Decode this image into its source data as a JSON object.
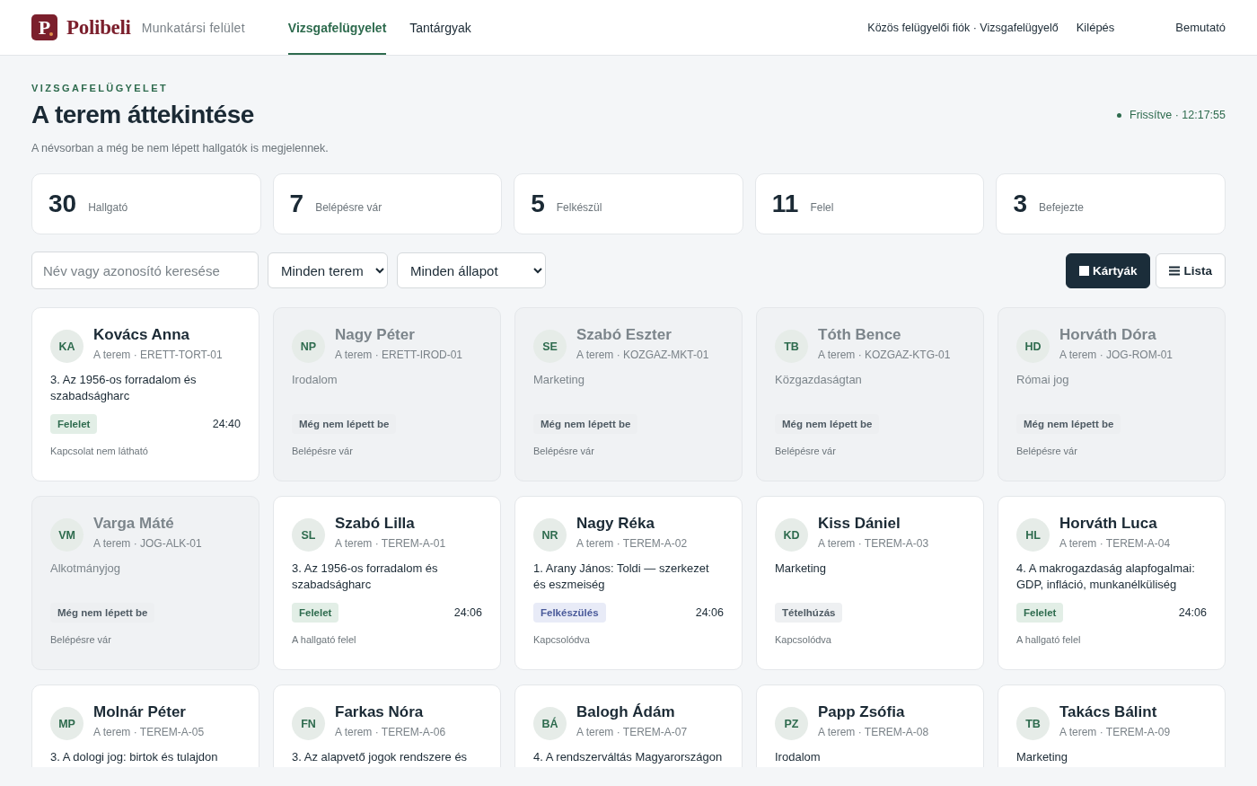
{
  "header": {
    "logo_letter": "P",
    "brand": "Polibeli",
    "subtitle": "Munkatársi felület",
    "tabs": [
      {
        "label": "Vizsgafelügyelet",
        "selected": true
      },
      {
        "label": "Tantárgyak",
        "selected": false
      }
    ],
    "account": "Közös felügyelői fiók · Vizsgafelügyelő",
    "logout": "Kilépés",
    "demo": "Bemutató"
  },
  "page": {
    "eyebrow": "VIZSGAFELÜGYELET",
    "title": "A terem áttekintése",
    "note": "A névsorban a még be nem lépett hallgatók is megjelennek.",
    "refreshed": "Frissítve · 12:17:55"
  },
  "stats": [
    {
      "value": "30",
      "label": "Hallgató"
    },
    {
      "value": "7",
      "label": "Belépésre vár"
    },
    {
      "value": "5",
      "label": "Felkészül"
    },
    {
      "value": "11",
      "label": "Felel"
    },
    {
      "value": "3",
      "label": "Befejezte"
    }
  ],
  "filters": {
    "search": {
      "placeholder": "Név vagy azonosító keresése"
    },
    "room": "Minden terem",
    "status": "Minden állapot",
    "views": [
      {
        "label": "Kártyák",
        "kind": "grid",
        "selected": true
      },
      {
        "label": "Lista",
        "kind": "list",
        "selected": false
      }
    ]
  },
  "students": [
    {
      "initials": "KA",
      "name": "Kovács Anna",
      "meta": "A terem · ERETT-TORT-01",
      "topic": "3. Az 1956-os forradalom és szabadságharc",
      "present": true,
      "badge": {
        "label": "Felelet",
        "kind": "answer"
      },
      "time": "24:40",
      "footer": "Kapcsolat nem látható"
    },
    {
      "initials": "NP",
      "name": "Nagy Péter",
      "meta": "A terem · ERETT-IROD-01",
      "topic": "Irodalom",
      "present": false,
      "badge": {
        "label": "Még nem lépett be",
        "kind": "absent"
      },
      "footer": "Belépésre vár"
    },
    {
      "initials": "SE",
      "name": "Szabó Eszter",
      "meta": "A terem · KOZGAZ-MKT-01",
      "topic": "Marketing",
      "present": false,
      "badge": {
        "label": "Még nem lépett be",
        "kind": "absent"
      },
      "footer": "Belépésre vár"
    },
    {
      "initials": "TB",
      "name": "Tóth Bence",
      "meta": "A terem · KOZGAZ-KTG-01",
      "topic": "Közgazdaságtan",
      "present": false,
      "badge": {
        "label": "Még nem lépett be",
        "kind": "absent"
      },
      "footer": "Belépésre vár"
    },
    {
      "initials": "HD",
      "name": "Horváth Dóra",
      "meta": "A terem · JOG-ROM-01",
      "topic": "Római jog",
      "present": false,
      "badge": {
        "label": "Még nem lépett be",
        "kind": "absent"
      },
      "footer": "Belépésre vár"
    },
    {
      "initials": "VM",
      "name": "Varga Máté",
      "meta": "A terem · JOG-ALK-01",
      "topic": "Alkotmányjog",
      "present": false,
      "badge": {
        "label": "Még nem lépett be",
        "kind": "absent"
      },
      "footer": "Belépésre vár"
    },
    {
      "initials": "SL",
      "name": "Szabó Lilla",
      "meta": "A terem · TEREM-A-01",
      "topic": "3. Az 1956-os forradalom és szabadságharc",
      "present": true,
      "badge": {
        "label": "Felelet",
        "kind": "answer"
      },
      "time": "24:06",
      "footer": "A hallgató felel"
    },
    {
      "initials": "NR",
      "name": "Nagy Réka",
      "meta": "A terem · TEREM-A-02",
      "topic": "1. Arany János: Toldi — szerkezet és eszmeiség",
      "present": true,
      "badge": {
        "label": "Felkészülés",
        "kind": "prep"
      },
      "time": "24:06",
      "footer": "Kapcsolódva"
    },
    {
      "initials": "KD",
      "name": "Kiss Dániel",
      "meta": "A terem · TEREM-A-03",
      "topic": "Marketing",
      "present": true,
      "badge": {
        "label": "Tételhúzás",
        "kind": "draw"
      },
      "footer": "Kapcsolódva"
    },
    {
      "initials": "HL",
      "name": "Horváth Luca",
      "meta": "A terem · TEREM-A-04",
      "topic": "4. A makrogazdaság alapfogalmai: GDP, infláció, munkanélküliség",
      "present": true,
      "badge": {
        "label": "Felelet",
        "kind": "answer"
      },
      "time": "24:06",
      "footer": "A hallgató felel"
    },
    {
      "initials": "MP",
      "name": "Molnár Péter",
      "meta": "A terem · TEREM-A-05",
      "topic": "3. A dologi jog: birtok és tulajdon",
      "present": true
    },
    {
      "initials": "FN",
      "name": "Farkas Nóra",
      "meta": "A terem · TEREM-A-06",
      "topic": "3. Az alapvető jogok rendszere és",
      "present": true
    },
    {
      "initials": "BÁ",
      "name": "Balogh Ádám",
      "meta": "A terem · TEREM-A-07",
      "topic": "4. A rendszerváltás Magyarországon",
      "present": true
    },
    {
      "initials": "PZ",
      "name": "Papp Zsófia",
      "meta": "A terem · TEREM-A-08",
      "topic": "Irodalom",
      "present": true
    },
    {
      "initials": "TB",
      "name": "Takács Bálint",
      "meta": "A terem · TEREM-A-09",
      "topic": "Marketing",
      "present": true
    }
  ]
}
